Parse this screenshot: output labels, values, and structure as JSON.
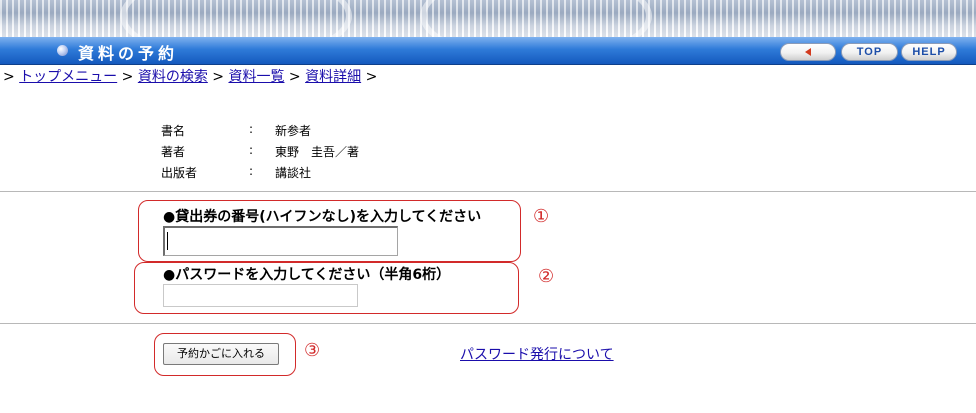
{
  "header": {
    "title": "資料の予約",
    "buttons": {
      "top": "TOP",
      "help": "HELP"
    }
  },
  "breadcrumb": {
    "items": [
      "トップメニュー",
      "資料の検索",
      "資料一覧",
      "資料詳細"
    ],
    "separator": ">"
  },
  "book": {
    "rows": [
      {
        "label": "書名",
        "colon": ":",
        "value": "新参者"
      },
      {
        "label": "著者",
        "colon": ":",
        "value": "東野　圭吾／著"
      },
      {
        "label": "出版者",
        "colon": ":",
        "value": "講談社"
      }
    ]
  },
  "form": {
    "card_label": "●貸出券の番号(ハイフンなし)を入力してください",
    "password_label": "●パスワードを入力してください（半角6桁）",
    "card_value": "",
    "password_value": "",
    "submit_label": "予約かごに入れる",
    "password_link": "パスワード発行について"
  },
  "annotations": {
    "one": "①",
    "two": "②",
    "three": "③"
  },
  "colors": {
    "annotation": "#d22a2a",
    "title_bar": "#1f66c9",
    "link": "#1a0dab"
  }
}
